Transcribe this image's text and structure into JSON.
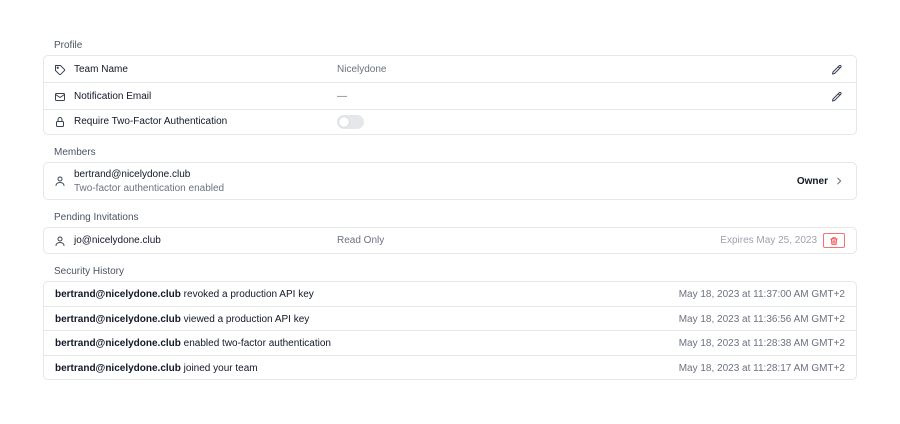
{
  "profile": {
    "section_title": "Profile",
    "team_name": {
      "label": "Team Name",
      "value": "Nicelydone",
      "icon": "tag-icon"
    },
    "notification_email": {
      "label": "Notification Email",
      "value": "—",
      "icon": "mail-icon"
    },
    "two_factor": {
      "label": "Require Two-Factor Authentication",
      "enabled": false,
      "icon": "lock-icon"
    }
  },
  "members": {
    "section_title": "Members",
    "items": [
      {
        "email": "bertrand@nicelydone.club",
        "subtitle": "Two-factor authentication enabled",
        "role": "Owner",
        "icon": "user-icon"
      }
    ]
  },
  "pending_invitations": {
    "section_title": "Pending Invitations",
    "items": [
      {
        "email": "jo@nicelydone.club",
        "role": "Read Only",
        "expires": "Expires May 25, 2023",
        "icon": "user-icon"
      }
    ]
  },
  "security_history": {
    "section_title": "Security History",
    "items": [
      {
        "actor": "bertrand@nicelydone.club",
        "action": "revoked a production API key",
        "time": "May 18, 2023 at 11:37:00 AM GMT+2"
      },
      {
        "actor": "bertrand@nicelydone.club",
        "action": "viewed a production API key",
        "time": "May 18, 2023 at 11:36:56 AM GMT+2"
      },
      {
        "actor": "bertrand@nicelydone.club",
        "action": "enabled two-factor authentication",
        "time": "May 18, 2023 at 11:28:38 AM GMT+2"
      },
      {
        "actor": "bertrand@nicelydone.club",
        "action": "joined your team",
        "time": "May 18, 2023 at 11:28:17 AM GMT+2"
      }
    ]
  },
  "colors": {
    "border": "#e5e7eb",
    "muted_text": "#6b7280",
    "danger": "#ef4444"
  }
}
